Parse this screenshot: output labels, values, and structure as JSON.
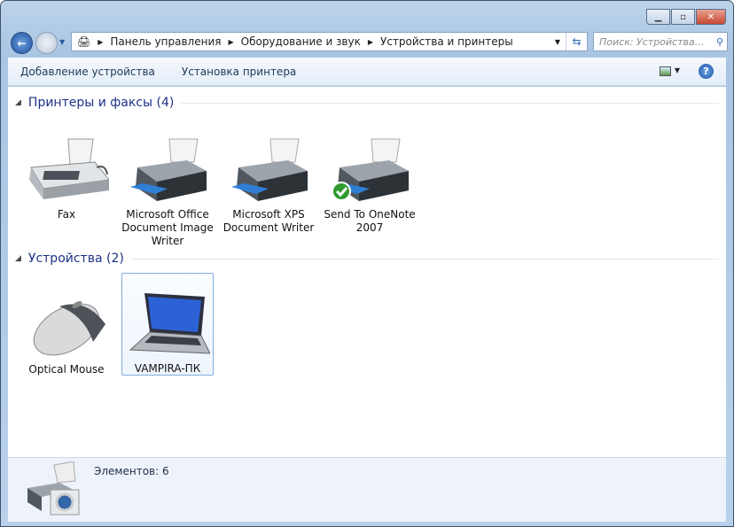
{
  "window": {
    "minimize": "minimize",
    "maximize": "maximize",
    "close": "close"
  },
  "address": {
    "crumbs": [
      "Панель управления",
      "Оборудование и звук",
      "Устройства и принтеры"
    ]
  },
  "search": {
    "placeholder": "Поиск: Устройства..."
  },
  "toolbar": {
    "add_device": "Добавление устройства",
    "add_printer": "Установка принтера"
  },
  "groups": [
    {
      "title": "Принтеры и факсы (4)",
      "items": [
        {
          "label": "Fax",
          "icon": "fax-icon"
        },
        {
          "label": "Microsoft Office Document Image Writer",
          "icon": "printer-icon"
        },
        {
          "label": "Microsoft XPS Document Writer",
          "icon": "printer-icon"
        },
        {
          "label": "Send To OneNote 2007",
          "icon": "printer-icon",
          "default": true
        }
      ]
    },
    {
      "title": "Устройства (2)",
      "items": [
        {
          "label": "Optical Mouse",
          "icon": "mouse-icon"
        },
        {
          "label": "VAMPIRA-ПК",
          "icon": "laptop-icon",
          "selected": true
        }
      ]
    }
  ],
  "status": {
    "text": "Элементов: 6"
  }
}
